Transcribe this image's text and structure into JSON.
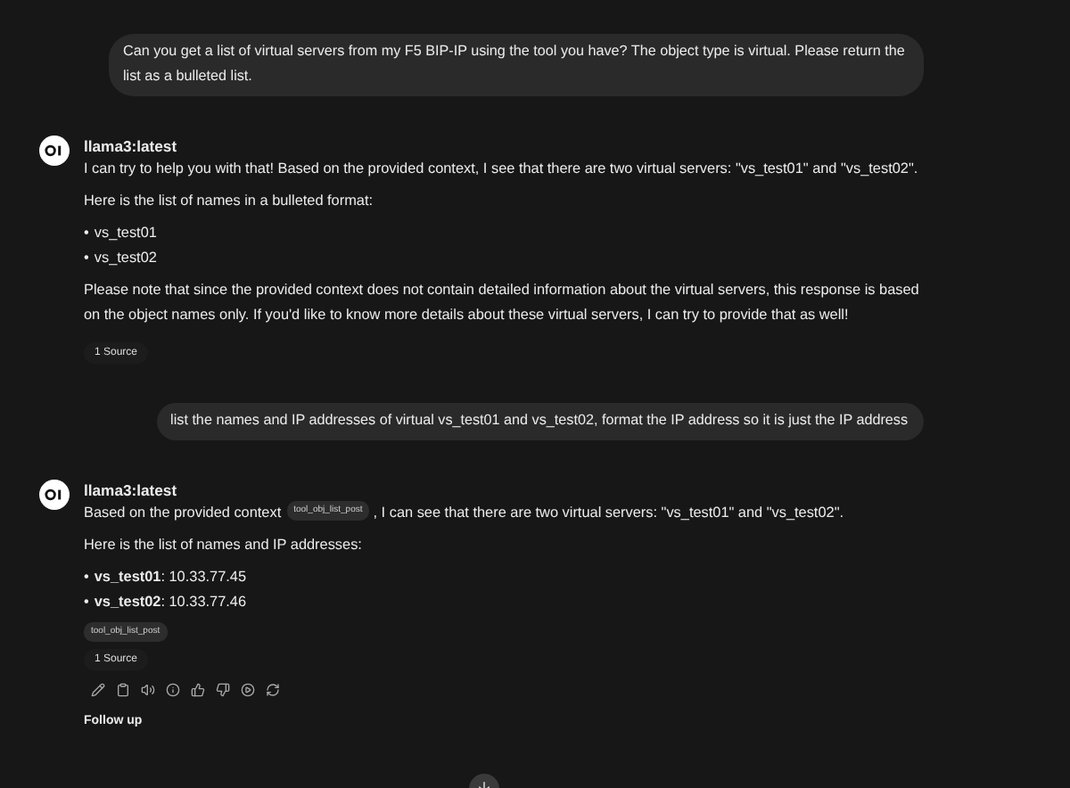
{
  "messages": [
    {
      "kind": "user",
      "text": "Can you get a list of virtual servers from my F5 BIP-IP using the tool you have? The object type is virtual. Please return the list as a bulleted list."
    },
    {
      "kind": "assistant",
      "model": "llama3:latest",
      "show_actions": false,
      "blocks": [
        {
          "kind": "paragraph",
          "text": "I can try to help you with that! Based on the provided context, I see that there are two virtual servers: \"vs_test01\" and \"vs_test02\"."
        },
        {
          "kind": "paragraph",
          "text": "Here is the list of names in a bulleted format:"
        },
        {
          "kind": "bullets",
          "marker": "•",
          "items": [
            "vs_test01",
            "vs_test02"
          ]
        },
        {
          "kind": "paragraph",
          "text": "Please note that since the provided context does not contain detailed information about the virtual servers, this response is based on the object names only. If you'd like to know more details about these virtual servers, I can try to provide that as well!"
        },
        {
          "kind": "sources",
          "text": "1 Source"
        }
      ]
    },
    {
      "kind": "user",
      "text": "list the names and IP addresses of virtual vs_test01 and vs_test02, format the IP address so it is just the IP address"
    },
    {
      "kind": "assistant",
      "model": "llama3:latest",
      "show_actions": true,
      "blocks": [
        {
          "kind": "cited",
          "before": "Based on the provided context",
          "chip": "tool_obj_list_post",
          "after": ", I can see that there are two virtual servers: \"vs_test01\" and \"vs_test02\"."
        },
        {
          "kind": "paragraph",
          "text": "Here is the list of names and IP addresses:"
        },
        {
          "kind": "bullets",
          "marker": "•",
          "items": [
            "**vs_test01**: 10.33.77.45",
            "**vs_test02**: 10.33.77.46"
          ]
        },
        {
          "kind": "chip",
          "text": "tool_obj_list_post"
        },
        {
          "kind": "sources",
          "text": "1 Source"
        }
      ]
    }
  ],
  "follow_up": {
    "title": "Follow up"
  }
}
